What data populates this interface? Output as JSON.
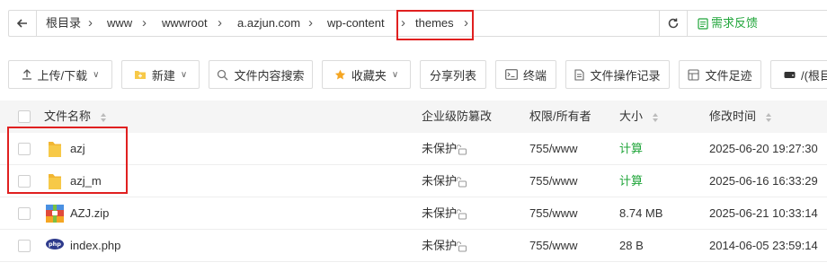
{
  "breadcrumb": {
    "items": [
      "根目录",
      "www",
      "wwwroot",
      "a.azjun.com",
      "wp-content",
      "themes"
    ],
    "feedback_label": "需求反馈"
  },
  "toolbar": {
    "upload_label": "上传/下载",
    "new_label": "新建",
    "search_content_label": "文件内容搜索",
    "favorites_label": "收藏夹",
    "share_list_label": "分享列表",
    "terminal_label": "终端",
    "file_log_label": "文件操作记录",
    "file_footprint_label": "文件足迹",
    "disk_label": "/(根目"
  },
  "table": {
    "headers": {
      "name": "文件名称",
      "protection": "企业级防篡改",
      "permission": "权限/所有者",
      "size": "大小",
      "mtime": "修改时间"
    },
    "rows": [
      {
        "name": "azj",
        "type": "folder",
        "protection": "未保护",
        "permission": "755/www",
        "size": "计算",
        "mtime": "2025-06-20 19:27:30"
      },
      {
        "name": "azj_m",
        "type": "folder",
        "protection": "未保护",
        "permission": "755/www",
        "size": "计算",
        "mtime": "2025-06-16 16:33:29"
      },
      {
        "name": "AZJ.zip",
        "type": "zip",
        "protection": "未保护",
        "permission": "755/www",
        "size": "8.74 MB",
        "mtime": "2025-06-21 10:33:14"
      },
      {
        "name": "index.php",
        "type": "php",
        "protection": "未保护",
        "permission": "755/www",
        "size": "28 B",
        "mtime": "2014-06-05 23:59:14"
      }
    ]
  },
  "colors": {
    "accent": "#20a53a",
    "highlight": "#e02020",
    "folder": "#f7c948"
  }
}
